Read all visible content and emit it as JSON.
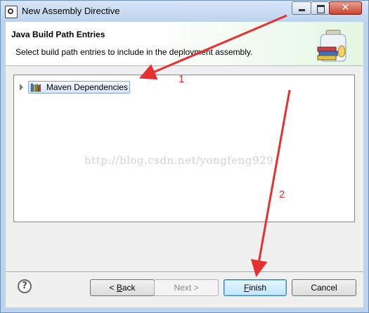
{
  "window": {
    "title": "New Assembly Directive",
    "controls": {
      "minimize": "minimize",
      "maximize": "maximize",
      "close": "✕"
    }
  },
  "header": {
    "title": "Java Build Path Entries",
    "description": "Select build path entries to include in the deployment assembly.",
    "icon": "jar-books-icon"
  },
  "tree": {
    "items": [
      {
        "label": "Maven Dependencies",
        "icon": "library-icon",
        "expanded": false
      }
    ]
  },
  "watermark": "http://blog.csdn.net/yongfeng929",
  "buttons": {
    "help": "?",
    "back": {
      "prefix": "< ",
      "mnemonic": "B",
      "rest": "ack"
    },
    "next": "Next >",
    "finish": {
      "mnemonic": "F",
      "rest": "inish"
    },
    "cancel": "Cancel"
  },
  "annotations": {
    "arrow1_label": "1",
    "arrow2_label": "2",
    "color": "#e83030"
  }
}
